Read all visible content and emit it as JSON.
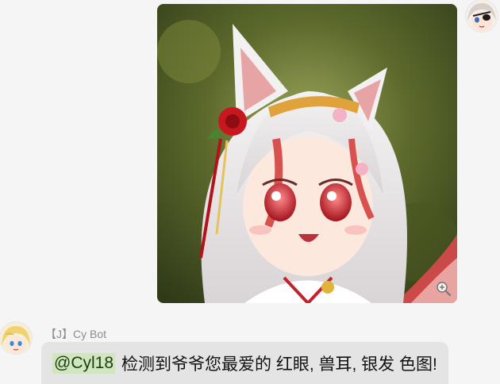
{
  "outgoing_message": {
    "type": "image",
    "image_icon": "anime-fox-girl-image",
    "zoom_icon": "zoom-in-icon"
  },
  "self_user": {
    "avatar_icon": "eyepatch-girl-avatar"
  },
  "incoming_message": {
    "sender_name": "【J】Cy Bot",
    "avatar_icon": "blonde-girl-avatar",
    "mention": "@Cyl18",
    "text": "检测到爷爷您最爱的 红眼, 兽耳, 银发 色图!"
  },
  "colors": {
    "background": "#f5f5f5",
    "bubble": "#e4e4e4",
    "mention_highlight": "#cfe6bf",
    "sender_name": "#8c8c8c"
  }
}
